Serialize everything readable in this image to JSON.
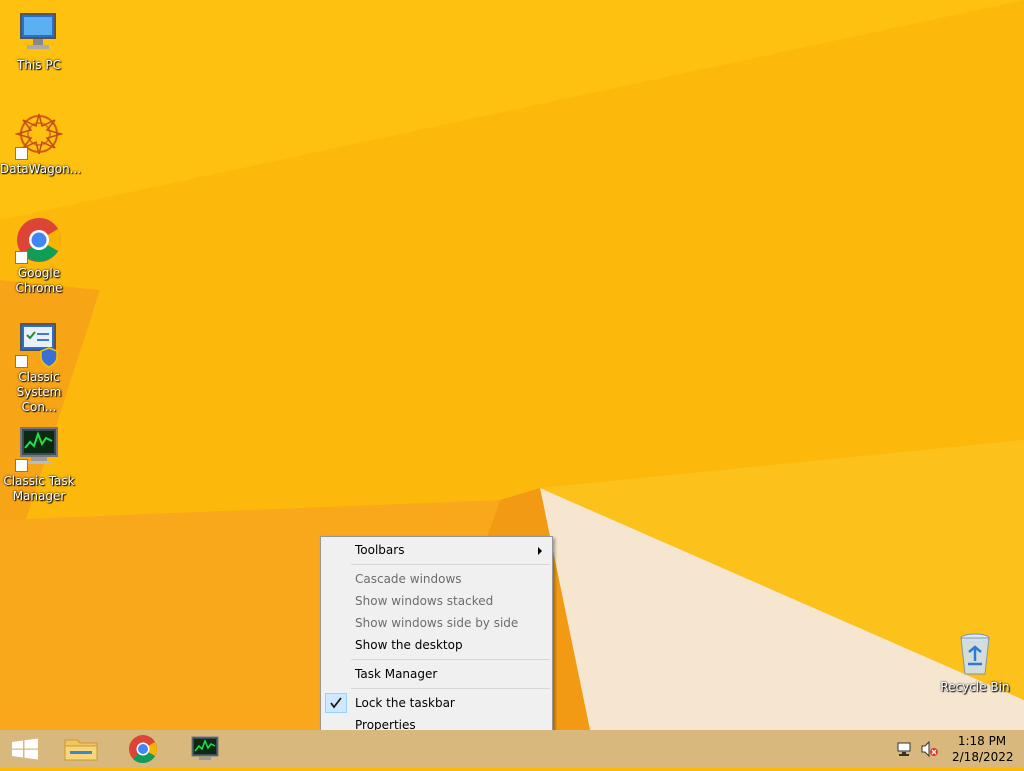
{
  "desktop": {
    "icons": [
      {
        "label": "This PC",
        "icon": "this-pc-icon"
      },
      {
        "label": "DataWagon...",
        "icon": "datawagon-icon"
      },
      {
        "label": "Google Chrome",
        "icon": "chrome-icon"
      },
      {
        "label": "Classic System Con...",
        "icon": "control-panel-icon"
      },
      {
        "label": "Classic Task Manager",
        "icon": "task-manager-icon"
      },
      {
        "label": "Recycle Bin",
        "icon": "recycle-bin-icon"
      }
    ]
  },
  "context_menu": {
    "items": [
      {
        "label": "Toolbars",
        "enabled": true,
        "submenu": true
      },
      {
        "label": "Cascade windows",
        "enabled": false
      },
      {
        "label": "Show windows stacked",
        "enabled": false
      },
      {
        "label": "Show windows side by side",
        "enabled": false
      },
      {
        "label": "Show the desktop",
        "enabled": true
      },
      {
        "label": "Task Manager",
        "enabled": true
      },
      {
        "label": "Lock the taskbar",
        "enabled": true,
        "checked": true
      },
      {
        "label": "Properties",
        "enabled": true
      }
    ]
  },
  "taskbar": {
    "buttons": [
      {
        "name": "start-button",
        "icon": "windows-logo-icon"
      },
      {
        "name": "file-explorer-button",
        "icon": "folder-icon"
      },
      {
        "name": "chrome-button",
        "icon": "chrome-icon"
      },
      {
        "name": "task-manager-button",
        "icon": "task-manager-icon"
      }
    ],
    "tray": {
      "network_icon": "network-icon",
      "volume_icon": "volume-muted-icon"
    },
    "clock": {
      "time": "1:18 PM",
      "date": "2/18/2022"
    }
  },
  "colors": {
    "wallpaper": "#fdb90b",
    "wallpaper_dark": "#f59a12",
    "wallpaper_light": "#f7ead7",
    "taskbar": "#d9b87e",
    "menu_bg": "#f0f0f0",
    "menu_disabled": "#6d6d6d"
  }
}
